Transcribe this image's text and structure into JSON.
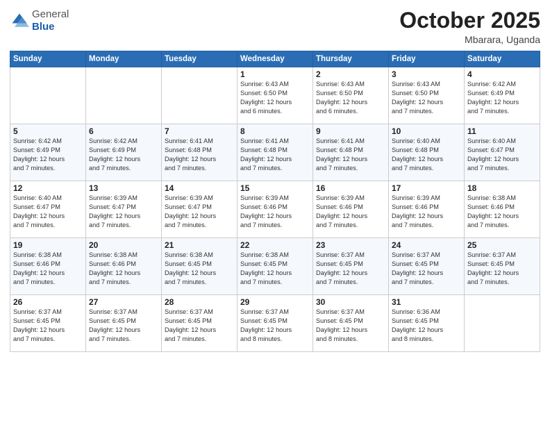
{
  "logo": {
    "general": "General",
    "blue": "Blue"
  },
  "header": {
    "month": "October 2025",
    "location": "Mbarara, Uganda"
  },
  "weekdays": [
    "Sunday",
    "Monday",
    "Tuesday",
    "Wednesday",
    "Thursday",
    "Friday",
    "Saturday"
  ],
  "weeks": [
    [
      {
        "day": "",
        "info": ""
      },
      {
        "day": "",
        "info": ""
      },
      {
        "day": "",
        "info": ""
      },
      {
        "day": "1",
        "info": "Sunrise: 6:43 AM\nSunset: 6:50 PM\nDaylight: 12 hours\nand 6 minutes."
      },
      {
        "day": "2",
        "info": "Sunrise: 6:43 AM\nSunset: 6:50 PM\nDaylight: 12 hours\nand 6 minutes."
      },
      {
        "day": "3",
        "info": "Sunrise: 6:43 AM\nSunset: 6:50 PM\nDaylight: 12 hours\nand 7 minutes."
      },
      {
        "day": "4",
        "info": "Sunrise: 6:42 AM\nSunset: 6:49 PM\nDaylight: 12 hours\nand 7 minutes."
      }
    ],
    [
      {
        "day": "5",
        "info": "Sunrise: 6:42 AM\nSunset: 6:49 PM\nDaylight: 12 hours\nand 7 minutes."
      },
      {
        "day": "6",
        "info": "Sunrise: 6:42 AM\nSunset: 6:49 PM\nDaylight: 12 hours\nand 7 minutes."
      },
      {
        "day": "7",
        "info": "Sunrise: 6:41 AM\nSunset: 6:48 PM\nDaylight: 12 hours\nand 7 minutes."
      },
      {
        "day": "8",
        "info": "Sunrise: 6:41 AM\nSunset: 6:48 PM\nDaylight: 12 hours\nand 7 minutes."
      },
      {
        "day": "9",
        "info": "Sunrise: 6:41 AM\nSunset: 6:48 PM\nDaylight: 12 hours\nand 7 minutes."
      },
      {
        "day": "10",
        "info": "Sunrise: 6:40 AM\nSunset: 6:48 PM\nDaylight: 12 hours\nand 7 minutes."
      },
      {
        "day": "11",
        "info": "Sunrise: 6:40 AM\nSunset: 6:47 PM\nDaylight: 12 hours\nand 7 minutes."
      }
    ],
    [
      {
        "day": "12",
        "info": "Sunrise: 6:40 AM\nSunset: 6:47 PM\nDaylight: 12 hours\nand 7 minutes."
      },
      {
        "day": "13",
        "info": "Sunrise: 6:39 AM\nSunset: 6:47 PM\nDaylight: 12 hours\nand 7 minutes."
      },
      {
        "day": "14",
        "info": "Sunrise: 6:39 AM\nSunset: 6:47 PM\nDaylight: 12 hours\nand 7 minutes."
      },
      {
        "day": "15",
        "info": "Sunrise: 6:39 AM\nSunset: 6:46 PM\nDaylight: 12 hours\nand 7 minutes."
      },
      {
        "day": "16",
        "info": "Sunrise: 6:39 AM\nSunset: 6:46 PM\nDaylight: 12 hours\nand 7 minutes."
      },
      {
        "day": "17",
        "info": "Sunrise: 6:39 AM\nSunset: 6:46 PM\nDaylight: 12 hours\nand 7 minutes."
      },
      {
        "day": "18",
        "info": "Sunrise: 6:38 AM\nSunset: 6:46 PM\nDaylight: 12 hours\nand 7 minutes."
      }
    ],
    [
      {
        "day": "19",
        "info": "Sunrise: 6:38 AM\nSunset: 6:46 PM\nDaylight: 12 hours\nand 7 minutes."
      },
      {
        "day": "20",
        "info": "Sunrise: 6:38 AM\nSunset: 6:46 PM\nDaylight: 12 hours\nand 7 minutes."
      },
      {
        "day": "21",
        "info": "Sunrise: 6:38 AM\nSunset: 6:45 PM\nDaylight: 12 hours\nand 7 minutes."
      },
      {
        "day": "22",
        "info": "Sunrise: 6:38 AM\nSunset: 6:45 PM\nDaylight: 12 hours\nand 7 minutes."
      },
      {
        "day": "23",
        "info": "Sunrise: 6:37 AM\nSunset: 6:45 PM\nDaylight: 12 hours\nand 7 minutes."
      },
      {
        "day": "24",
        "info": "Sunrise: 6:37 AM\nSunset: 6:45 PM\nDaylight: 12 hours\nand 7 minutes."
      },
      {
        "day": "25",
        "info": "Sunrise: 6:37 AM\nSunset: 6:45 PM\nDaylight: 12 hours\nand 7 minutes."
      }
    ],
    [
      {
        "day": "26",
        "info": "Sunrise: 6:37 AM\nSunset: 6:45 PM\nDaylight: 12 hours\nand 7 minutes."
      },
      {
        "day": "27",
        "info": "Sunrise: 6:37 AM\nSunset: 6:45 PM\nDaylight: 12 hours\nand 7 minutes."
      },
      {
        "day": "28",
        "info": "Sunrise: 6:37 AM\nSunset: 6:45 PM\nDaylight: 12 hours\nand 7 minutes."
      },
      {
        "day": "29",
        "info": "Sunrise: 6:37 AM\nSunset: 6:45 PM\nDaylight: 12 hours\nand 8 minutes."
      },
      {
        "day": "30",
        "info": "Sunrise: 6:37 AM\nSunset: 6:45 PM\nDaylight: 12 hours\nand 8 minutes."
      },
      {
        "day": "31",
        "info": "Sunrise: 6:36 AM\nSunset: 6:45 PM\nDaylight: 12 hours\nand 8 minutes."
      },
      {
        "day": "",
        "info": ""
      }
    ]
  ]
}
